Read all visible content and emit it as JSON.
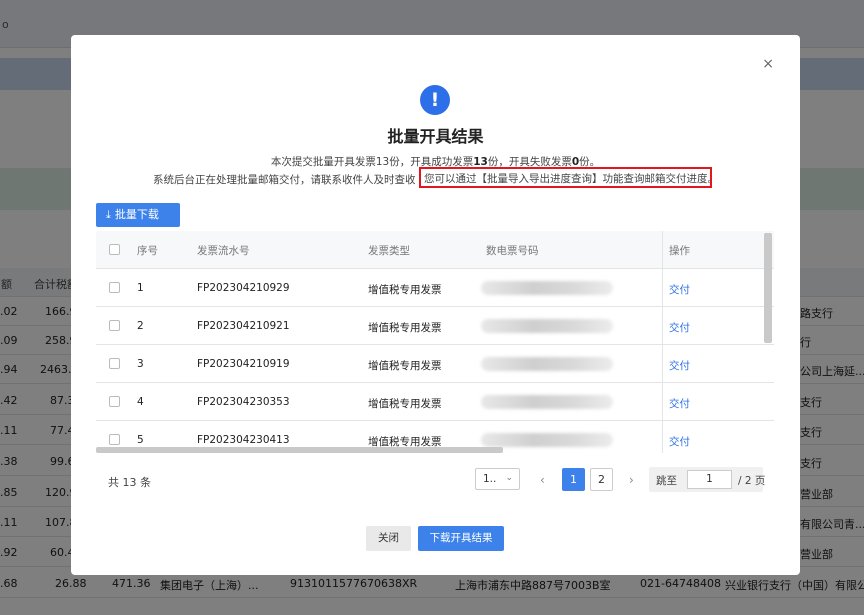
{
  "background": {
    "top_label": "ο",
    "table_header": [
      "额",
      "合计税额"
    ],
    "rows": [
      {
        "c1": ".02",
        "c2": "166.9",
        "right": "路支行"
      },
      {
        "c1": ".09",
        "c2": "258.9",
        "right": "行"
      },
      {
        "c1": ".94",
        "c2": "2463.0",
        "right": "公司上海延..."
      },
      {
        "c1": ".42",
        "c2": "87.3",
        "right": "支行"
      },
      {
        "c1": ".11",
        "c2": "77.4",
        "right": "支行"
      },
      {
        "c1": ".38",
        "c2": "99.6",
        "right": "支行"
      },
      {
        "c1": ".85",
        "c2": "120.9",
        "right": "营业部"
      },
      {
        "c1": ".11",
        "c2": "107.8",
        "right": "有限公司青..."
      },
      {
        "c1": ".92",
        "c2": "60.4",
        "right": "营业部"
      },
      {
        "c1": ".68",
        "c2": "26.88",
        "c3": "471.36",
        "c4": "集团电子（上海）...",
        "c5": "9131011577670638XR",
        "c6": "上海市浦东中路887号7003B室",
        "c7": "021-64748408",
        "right": "兴业银行支行（中国）有限公司..."
      }
    ]
  },
  "modal": {
    "close_icon": "×",
    "alert_icon": "!",
    "title": "批量开具结果",
    "summary_prefix": "本次提交批量开具发票13份，开具成功发票",
    "summary_success": "13",
    "summary_mid": "份，开具失败发票",
    "summary_fail": "0",
    "summary_suffix": "份。",
    "notice": "系统后台正在处理批量邮箱交付，请联系收件人及时查收",
    "hint": "您可以通过【批量导入导出进度查询】功能查询邮箱交付进度。",
    "batch_download_label": "批量下载",
    "download_icon": "download-icon",
    "table": {
      "headers": {
        "index": "序号",
        "serial": "发票流水号",
        "type": "发票类型",
        "number": "数电票号码",
        "action": "操作"
      },
      "rows": [
        {
          "index": "1",
          "serial": "FP202304210929",
          "type": "增值税专用发票",
          "action": "交付"
        },
        {
          "index": "2",
          "serial": "FP202304210921",
          "type": "增值税专用发票",
          "action": "交付"
        },
        {
          "index": "3",
          "serial": "FP202304210919",
          "type": "增值税专用发票",
          "action": "交付"
        },
        {
          "index": "4",
          "serial": "FP202304230353",
          "type": "增值税专用发票",
          "action": "交付"
        },
        {
          "index": "5",
          "serial": "FP202304230413",
          "type": "增值税专用发票",
          "action": "交付"
        }
      ]
    },
    "pagination": {
      "total": "共 13 条",
      "page_size": "1..",
      "prev": "‹",
      "next": "›",
      "pages": [
        "1",
        "2"
      ],
      "current_page": "1",
      "jump_label": "跳至",
      "jump_value": "1",
      "total_pages": "/ 2 页"
    },
    "footer": {
      "close_label": "关闭",
      "download_label": "下载开具结果"
    },
    "colors": {
      "primary": "#3d82ea",
      "highlight_border": "#e0181b"
    }
  }
}
